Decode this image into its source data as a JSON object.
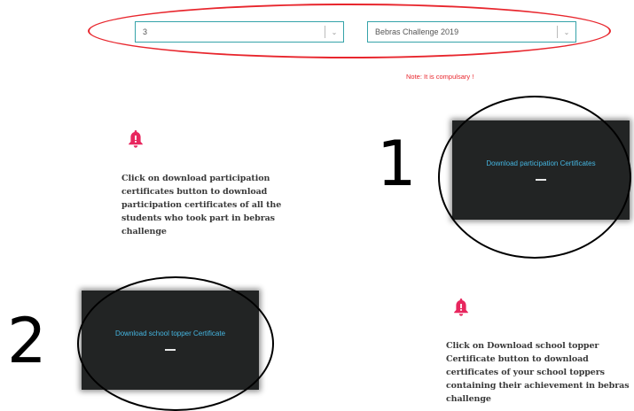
{
  "filters": {
    "class_select": {
      "value": "3"
    },
    "challenge_select": {
      "value": "Bebras Challenge 2019"
    }
  },
  "note": "Note: It is compulsary !",
  "participation": {
    "description": "Click on download participation certificates button to download participation certificates of all the students who took part in bebras challenge",
    "button_label": "Download participation Certificates",
    "step_number": "1"
  },
  "topper": {
    "description": "Click on Download school topper Certificate button to download certificates of your school toppers containing their achievement in bebras challenge",
    "button_label": "Download school topper Certificate",
    "step_number": "2"
  },
  "colors": {
    "accent_teal": "#35a3a9",
    "alert_pink": "#e8265e",
    "annotation_red": "#e8262d",
    "button_bg": "#222424",
    "button_text": "#45b5e0"
  },
  "icons": [
    "bell-icon",
    "chevron-down-icon"
  ]
}
